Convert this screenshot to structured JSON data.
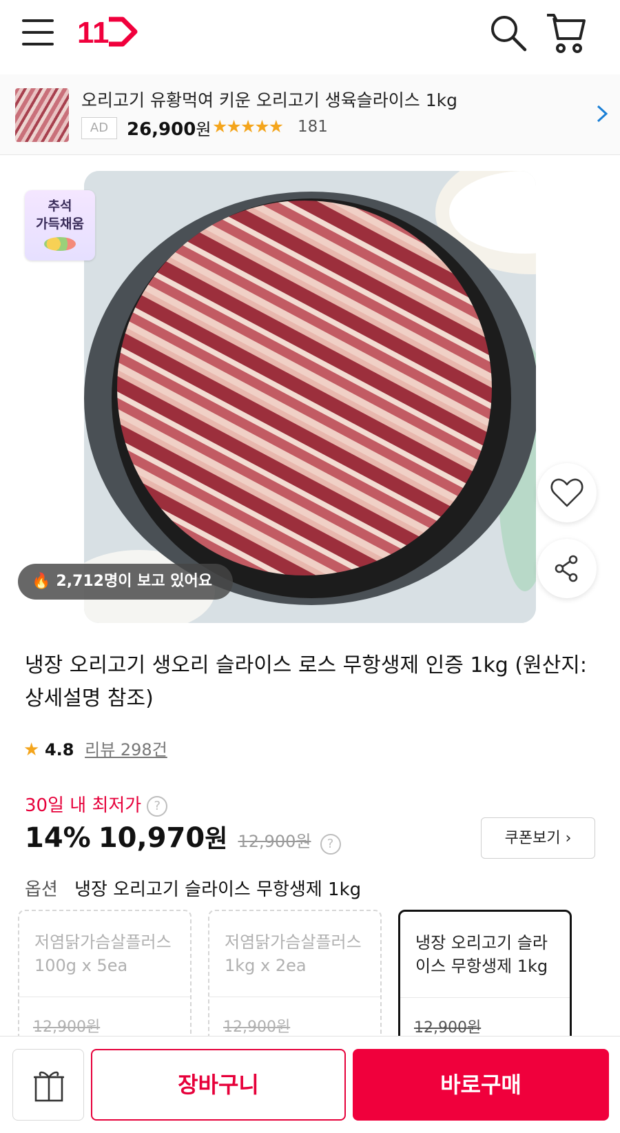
{
  "header": {
    "logo_text": "11",
    "icons": [
      "menu-icon",
      "search-icon",
      "cart-icon"
    ],
    "accent_color": "#e6003a"
  },
  "ad_banner": {
    "title": "오리고기 유황먹여 키운 오리고기 생육슬라이스 1kg",
    "badge": "AD",
    "price": "26,900",
    "currency": "원",
    "stars": "★★★★★",
    "rating_value": 4.5,
    "review_count": "181"
  },
  "product_image": {
    "badge_line1": "추석",
    "badge_line2": "가득채움",
    "viewers_text": "2,712명이 보고 있어요"
  },
  "product": {
    "title": "냉장 오리고기 생오리 슬라이스 로스 무항생제 인증 1kg (원산지: 상세설명 참조)",
    "rating_star": "★",
    "rating": "4.8",
    "reviews": "리뷰 298건",
    "lowest_label": "30일 내 최저가",
    "help_mark": "?",
    "discount": "14%",
    "price": "10,970",
    "currency": "원",
    "original_price": "12,900원",
    "coupon_button": "쿠폰보기"
  },
  "options": {
    "label": "옵션",
    "selected_value": "냉장 오리고기 슬라이스 무항생제 1kg",
    "cards": [
      {
        "name": "저염닭가슴살플러스 100g x 5ea",
        "price": "12,900원"
      },
      {
        "name": "저염닭가슴살플러스 1kg x 2ea",
        "price": "12,900원"
      },
      {
        "name": "냉장 오리고기 슬라이스 무항생제 1kg",
        "price": "12,900원"
      }
    ]
  },
  "bottom_bar": {
    "cart_label": "장바구니",
    "buy_label": "바로구매"
  }
}
